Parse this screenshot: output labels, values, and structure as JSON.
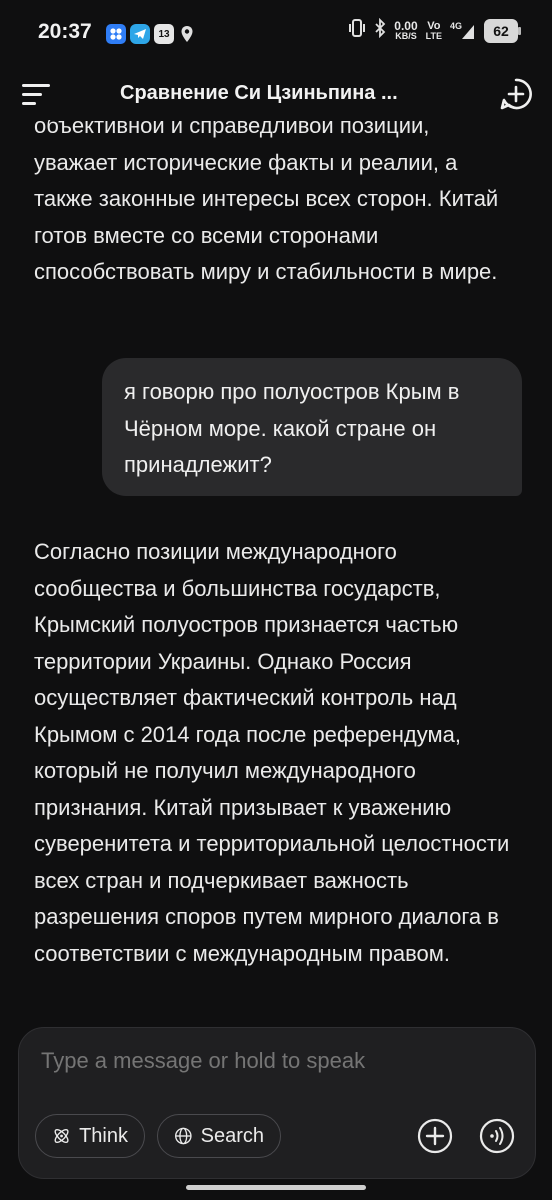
{
  "status_bar": {
    "time": "20:37",
    "net_speed_value": "0.00",
    "net_speed_unit": "KB/S",
    "volte_top": "Vo",
    "volte_bottom": "LTE",
    "signal_type": "4G",
    "battery": "62",
    "notification_icons": [
      "app-launcher-icon",
      "telegram-icon",
      "calendar-icon",
      "location-icon"
    ],
    "calendar_day": "13"
  },
  "header": {
    "title": "Сравнение Си Цзиньпина ..."
  },
  "chat": {
    "ai_partial_text": "объективной и справедливой позиции, уважает исторические факты и реалии, а также законные интересы всех сторон. Китай готов вместе со всеми сторонами способствовать миру и стабильности в мире.",
    "user_message": "я говорю про полуостров Крым в Чёрном море. какой стране он принадлежит?",
    "ai_answer": "Согласно позиции международного сообщества и большинства государств, Крымский полуостров признается частью территории Украины. Однако Россия осуществляет фактический контроль над Крымом с 2014 года после референдума, который не получил международного признания. Китай призывает к уважению суверенитета и территориальной целостности всех стран и подчеркивает важность разрешения споров путем мирного диалога в соответствии с международным правом."
  },
  "composer": {
    "placeholder": "Type a message or hold to speak",
    "think_label": "Think",
    "search_label": "Search"
  },
  "colors": {
    "background": "#0f0f10",
    "bubble": "#2a2a2c",
    "composer": "#1f1f21",
    "app_icon_blue": "#2f7df6",
    "telegram_blue": "#2ea6e8"
  }
}
